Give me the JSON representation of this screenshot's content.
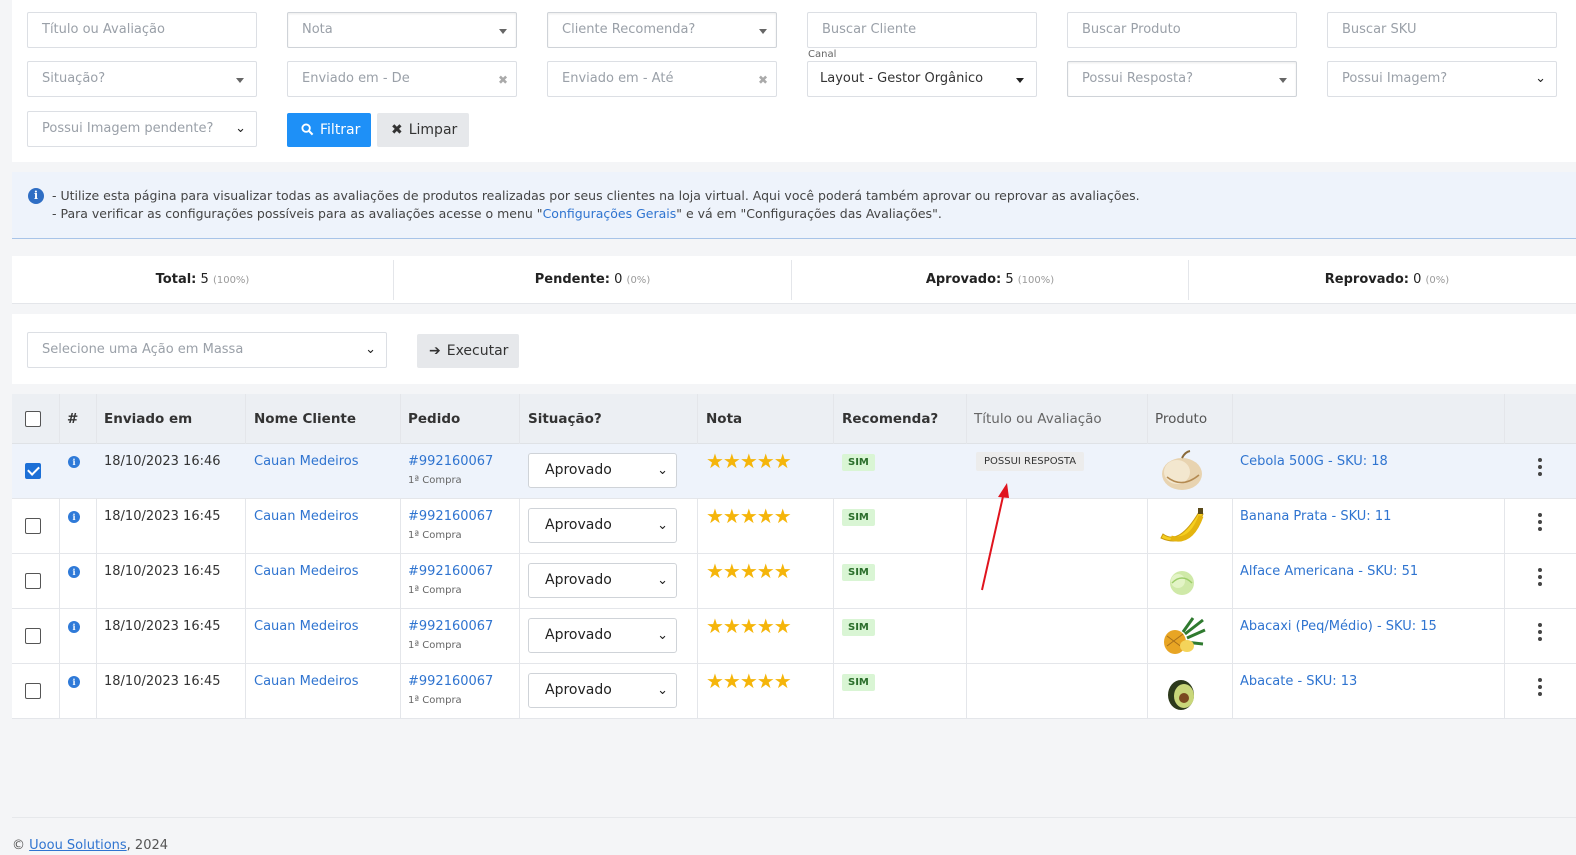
{
  "filters": {
    "titulo_placeholder": "Título ou Avaliação",
    "nota_placeholder": "Nota",
    "cliente_recomenda_placeholder": "Cliente Recomenda?",
    "buscar_cliente_placeholder": "Buscar Cliente",
    "buscar_produto_placeholder": "Buscar Produto",
    "buscar_sku_placeholder": "Buscar SKU",
    "situacao_placeholder": "Situação?",
    "enviado_de_placeholder": "Enviado em - De",
    "enviado_ate_placeholder": "Enviado em - Até",
    "canal_label": "Canal",
    "canal_value": "Layout - Gestor Orgânico",
    "possui_resposta_placeholder": "Possui Resposta?",
    "possui_imagem_placeholder": "Possui Imagem?",
    "possui_imagem_pendente_placeholder": "Possui Imagem pendente?",
    "filtrar_label": "Filtrar",
    "limpar_label": "Limpar"
  },
  "info": {
    "line1": "- Utilize esta página para visualizar todas as avaliações de produtos realizadas por seus clientes na loja virtual. Aqui você poderá também aprovar ou reprovar as avaliações.",
    "line2_prefix": "- Para verificar as configurações possíveis para as avaliações acesse o menu \"",
    "line2_link": "Configurações Gerais",
    "line2_suffix": "\" e vá em \"Configurações das Avaliações\"."
  },
  "stats": [
    {
      "label": "Total:",
      "value": "5",
      "pct": "(100%)"
    },
    {
      "label": "Pendente:",
      "value": "0",
      "pct": "(0%)"
    },
    {
      "label": "Aprovado:",
      "value": "5",
      "pct": "(100%)"
    },
    {
      "label": "Reprovado:",
      "value": "0",
      "pct": "(0%)"
    }
  ],
  "mass": {
    "select_placeholder": "Selecione uma Ação em Massa",
    "executar_label": "Executar"
  },
  "table": {
    "headers": {
      "num": "#",
      "enviado": "Enviado em",
      "cliente": "Nome Cliente",
      "pedido": "Pedido",
      "situacao": "Situação?",
      "nota": "Nota",
      "recomenda": "Recomenda?",
      "titulo": "Título ou Avaliação",
      "produto": "Produto"
    },
    "rows": [
      {
        "checked": true,
        "enviado": "18/10/2023 16:46",
        "cliente": "Cauan Medeiros",
        "pedido": "#992160067",
        "compra": "1ª Compra",
        "situacao": "Aprovado",
        "stars": "★★★★★",
        "rating": 5,
        "recomenda": "SIM",
        "titulo": "POSSUI RESPOSTA",
        "produto": "Cebola 500G - SKU: 18",
        "img": "onion-icon"
      },
      {
        "checked": false,
        "enviado": "18/10/2023 16:45",
        "cliente": "Cauan Medeiros",
        "pedido": "#992160067",
        "compra": "1ª Compra",
        "situacao": "Aprovado",
        "stars": "★★★★★",
        "rating": 5,
        "recomenda": "SIM",
        "titulo": "",
        "produto": "Banana Prata - SKU: 11",
        "img": "banana-icon"
      },
      {
        "checked": false,
        "enviado": "18/10/2023 16:45",
        "cliente": "Cauan Medeiros",
        "pedido": "#992160067",
        "compra": "1ª Compra",
        "situacao": "Aprovado",
        "stars": "★★★★★",
        "rating": 5,
        "recomenda": "SIM",
        "titulo": "",
        "produto": "Alface Americana - SKU: 51",
        "img": "lettuce-icon"
      },
      {
        "checked": false,
        "enviado": "18/10/2023 16:45",
        "cliente": "Cauan Medeiros",
        "pedido": "#992160067",
        "compra": "1ª Compra",
        "situacao": "Aprovado",
        "stars": "★★★★★",
        "rating": 5,
        "recomenda": "SIM",
        "titulo": "",
        "produto": "Abacaxi (Peq/Médio) - SKU: 15",
        "img": "pineapple-icon"
      },
      {
        "checked": false,
        "enviado": "18/10/2023 16:45",
        "cliente": "Cauan Medeiros",
        "pedido": "#992160067",
        "compra": "1ª Compra",
        "situacao": "Aprovado",
        "stars": "★★★★★",
        "rating": 5,
        "recomenda": "SIM",
        "titulo": "",
        "produto": "Abacate - SKU: 13",
        "img": "avocado-icon"
      }
    ]
  },
  "footer": {
    "prefix": "© ",
    "company": "Uoou Solutions",
    "suffix": ", 2024"
  },
  "colors": {
    "primary": "#1e90f7",
    "link": "#2f74d0",
    "star": "#f5b50a",
    "annotation_arrow": "#e0141e"
  }
}
